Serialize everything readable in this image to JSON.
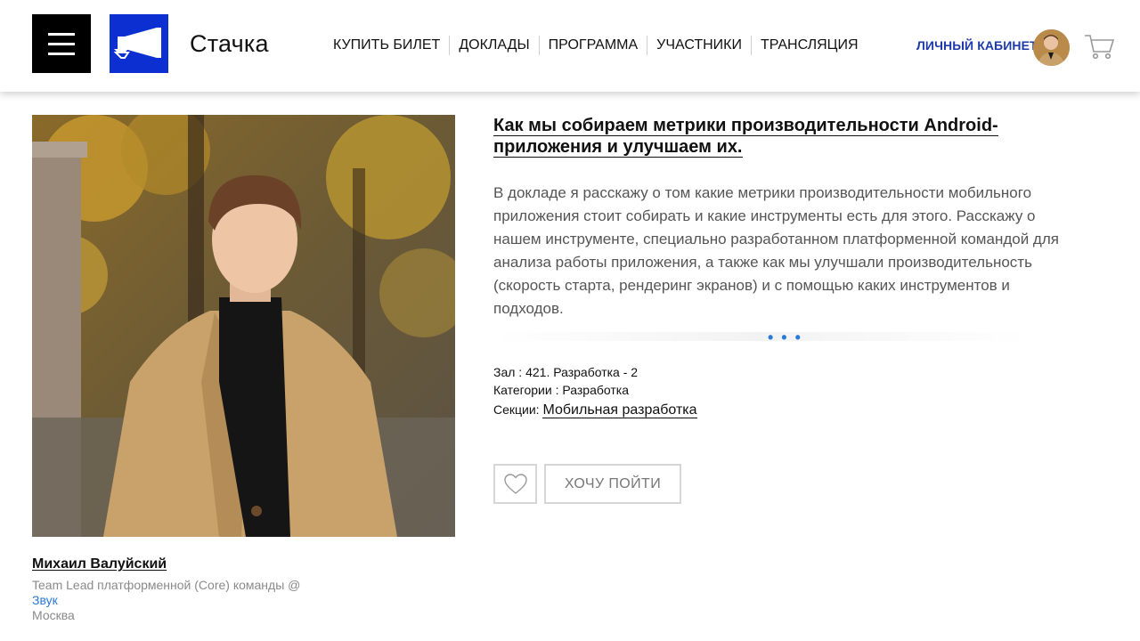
{
  "header": {
    "brand": "Стачка",
    "nav": [
      "КУПИТЬ БИЛЕТ",
      "ДОКЛАДЫ",
      "ПРОГРАММА",
      "УЧАСТНИКИ",
      "ТРАНСЛЯЦИЯ"
    ],
    "cabinet_label": "ЛИЧНЫЙ КАБИНЕТ",
    "icons": {
      "menu": "hamburger-icon",
      "logo": "megaphone-icon",
      "cart": "cart-icon"
    },
    "colors": {
      "logo_bg": "#0b2fd1",
      "cabinet": "#1e3aa8"
    }
  },
  "talk": {
    "title": "Как мы собираем метрики производительности Android-приложения и улучшаем их.",
    "description": "В докладе я расскажу о том какие метрики производительности мобильного приложения стоит собирать и какие инструменты есть для этого. Расскажу о нашем инструменте, специально разработанном платформенной командой для анализа работы приложения, а также как мы улучшали производительность (скорость старта, рендеринг экранов) и с помощью каких инструментов и подходов.",
    "more": "• • •",
    "hall": "Зал : 421. Разработка - 2",
    "categories": "Категории : Разработка",
    "sections_label": "Секции:",
    "section": "Мобильная разработка",
    "want_to_go": "ХОЧУ ПОЙТИ"
  },
  "speaker": {
    "name": "Михаил Валуйский",
    "role": "Team Lead платформенной (Core) команды @",
    "company": "Звук",
    "city": "Москва"
  }
}
